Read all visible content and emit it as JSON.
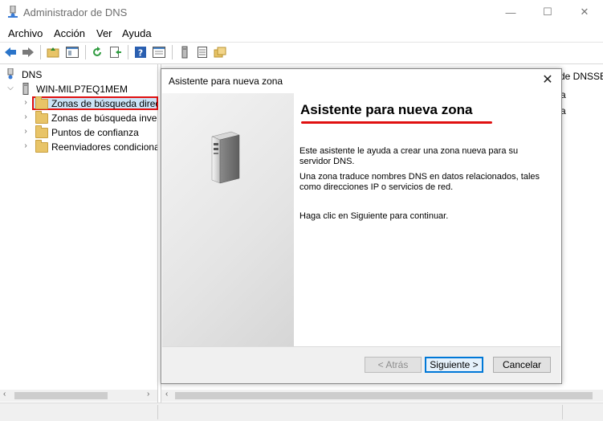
{
  "window": {
    "title": "Administrador de DNS",
    "controls": [
      "—",
      "☐",
      "✕"
    ]
  },
  "menu": [
    "Archivo",
    "Acción",
    "Ver",
    "Ayuda"
  ],
  "tree": {
    "root": "DNS",
    "server": "WIN-MILP7EQ1MEM",
    "items": [
      {
        "label": "Zonas de búsqueda directa",
        "selected": true
      },
      {
        "label": "Zonas de búsqueda inversa",
        "selected": false
      },
      {
        "label": "Puntos de confianza",
        "selected": false
      },
      {
        "label": "Reenviadores condicionales",
        "selected": false
      }
    ]
  },
  "right_pane": {
    "header_fragment": "de DNSSEC",
    "line1": "a",
    "line2": "a"
  },
  "dialog": {
    "title": "Asistente para nueva zona",
    "heading": "Asistente para nueva zona",
    "p1": "Este asistente le ayuda a crear una zona nueva para su servidor DNS.",
    "p2": "Una zona traduce nombres DNS en datos relacionados, tales como direcciones IP o servicios de red.",
    "p3": "Haga clic en Siguiente para continuar.",
    "btn_back": "< Atrás",
    "btn_next": "Siguiente >",
    "btn_cancel": "Cancelar",
    "close": "✕"
  },
  "colors": {
    "highlight_red": "#e01010",
    "accent_blue": "#0078d7",
    "folder": "#e8c468"
  },
  "icons": [
    "dns-app-icon",
    "back-arrow-icon",
    "forward-arrow-icon",
    "up-folder-icon",
    "console-tree-icon",
    "refresh-icon",
    "export-icon",
    "help-icon",
    "properties-icon",
    "server-icon",
    "list-icon",
    "folder-icon",
    "server-tower-icon"
  ]
}
